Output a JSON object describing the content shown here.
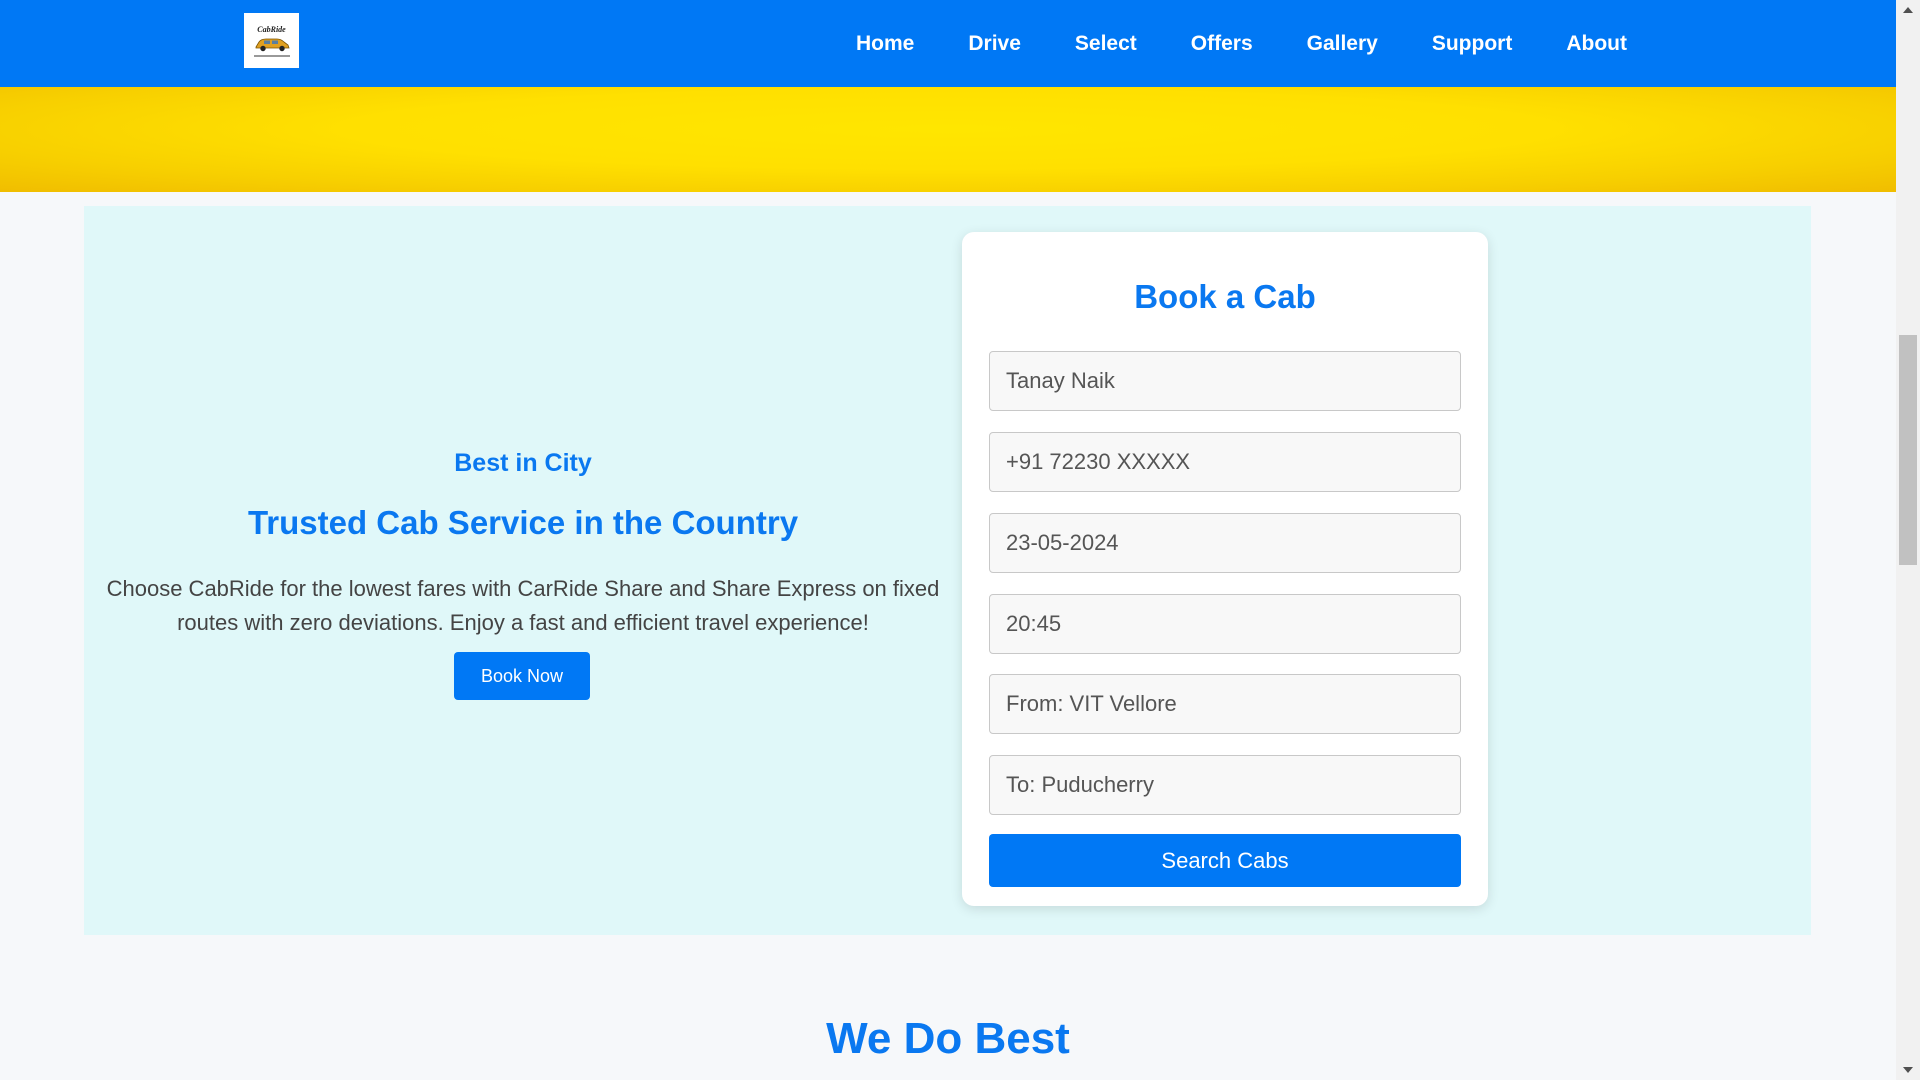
{
  "navbar": {
    "logo_text": "CabRide",
    "links": [
      "Home",
      "Drive",
      "Select",
      "Offers",
      "Gallery",
      "Support",
      "About"
    ]
  },
  "hero": {
    "tagline": "Best in City",
    "title": "Trusted Cab Service in the Country",
    "description": "Choose CabRide for the lowest fares with CarRide Share and Share Express on fixed routes with zero deviations. Enjoy a fast and efficient travel experience!",
    "book_now_label": "Book Now"
  },
  "booking": {
    "title": "Book a Cab",
    "fields": {
      "name": "Tanay Naik",
      "phone": "+91 72230 XXXXX",
      "date": "23-05-2024",
      "time": "20:45",
      "from": "From: VIT Vellore",
      "to": "To: Puducherry"
    },
    "search_label": "Search Cabs"
  },
  "sections": {
    "we_do_best": "We Do Best"
  },
  "colors": {
    "primary": "#0078f5",
    "hero_yellow": "#ffe000",
    "section_bg": "#e0f8f9",
    "page_bg": "#f6f8fa"
  },
  "icons": {
    "logo": "car-logo-icon",
    "scroll_up": "scroll-up-arrow-icon",
    "scroll_down": "scroll-down-arrow-icon"
  }
}
